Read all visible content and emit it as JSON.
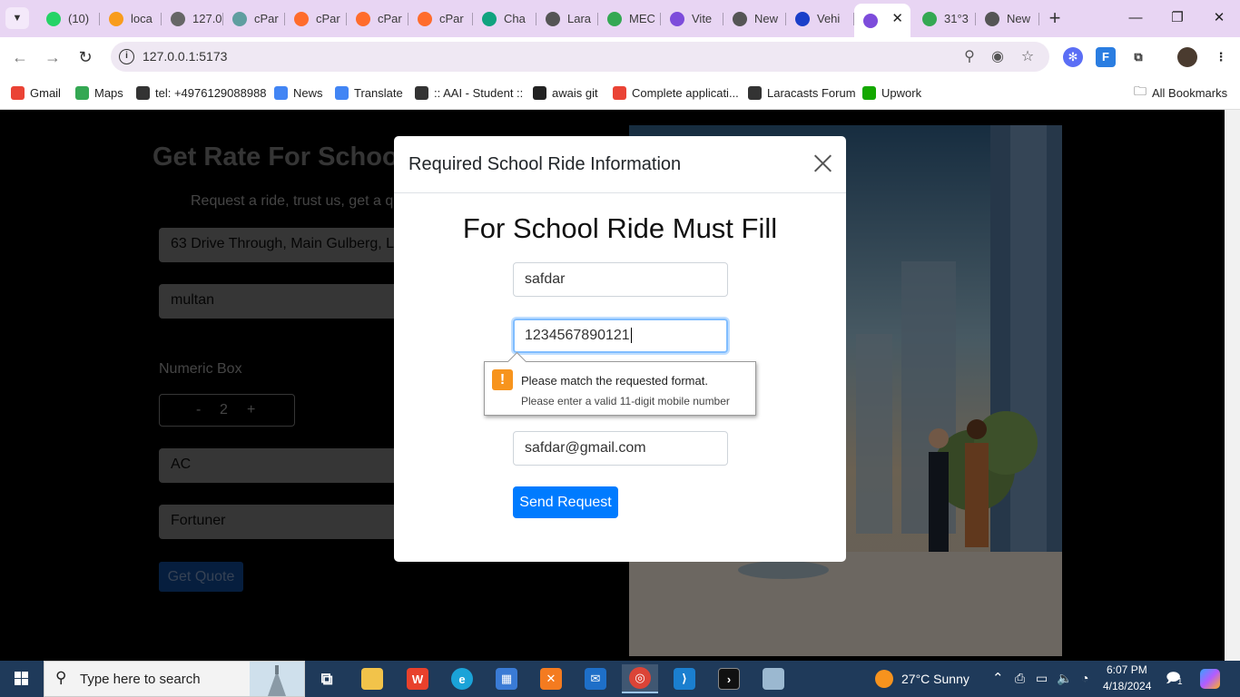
{
  "browser": {
    "tabs": [
      {
        "label": "(10)",
        "icon": "whatsapp-icon",
        "color": "#25d366"
      },
      {
        "label": "loca",
        "icon": "phpmyadmin-icon",
        "color": "#f89c1c"
      },
      {
        "label": "127.0",
        "icon": "globe-icon",
        "color": "#666666"
      },
      {
        "label": "cPar",
        "icon": "cpanel-icon",
        "color": "#5f9ea0"
      },
      {
        "label": "cPar",
        "icon": "cpanel-icon",
        "color": "#ff6c2c"
      },
      {
        "label": "cPar",
        "icon": "cpanel-icon",
        "color": "#ff6c2c"
      },
      {
        "label": "cPar",
        "icon": "cpanel-icon",
        "color": "#ff6c2c"
      },
      {
        "label": "Cha",
        "icon": "chatgpt-icon",
        "color": "#10a37f"
      },
      {
        "label": "Lara",
        "icon": "globe-icon",
        "color": "#555555"
      },
      {
        "label": "MEC",
        "icon": "maps-pin-icon",
        "color": "#34a853"
      },
      {
        "label": "Vite",
        "icon": "vite-icon",
        "color": "#7d4cdb"
      },
      {
        "label": "New",
        "icon": "globe-icon",
        "color": "#555555"
      },
      {
        "label": "Vehi",
        "icon": "shield-icon",
        "color": "#1a3fc9"
      },
      {
        "label": "",
        "icon": "vite-icon",
        "color": "#7d4cdb",
        "active": true
      },
      {
        "label": "31°3",
        "icon": "maps-pin-icon",
        "color": "#34a853"
      },
      {
        "label": "New",
        "icon": "globe-icon",
        "color": "#555555"
      }
    ],
    "close_tab_glyph": "✕",
    "new_tab_glyph": "+",
    "window_controls": {
      "minimize": "—",
      "restore": "❐",
      "close": "✕"
    },
    "url": "127.0.0.1:5173",
    "bookmarks": [
      {
        "label": "Gmail",
        "icon": "gmail-icon",
        "color": "#ea4335"
      },
      {
        "label": "Maps",
        "icon": "maps-pin-icon",
        "color": "#34a853"
      },
      {
        "label": "tel: +4976129088988",
        "icon": "globe-icon",
        "color": "#333333"
      },
      {
        "label": "News",
        "icon": "google-news-icon",
        "color": "#4285f4"
      },
      {
        "label": "Translate",
        "icon": "translate-icon",
        "color": "#4285f4"
      },
      {
        "label": ":: AAI - Student ::",
        "icon": "globe-icon",
        "color": "#333333"
      },
      {
        "label": "awais git",
        "icon": "github-icon",
        "color": "#222222"
      },
      {
        "label": "Complete applicati...",
        "icon": "google-icon",
        "color": "#ea4335"
      },
      {
        "label": "Laracasts Forum",
        "icon": "paper-plane-icon",
        "color": "#333333"
      },
      {
        "label": "Upwork",
        "icon": "upwork-icon",
        "color": "#14a800"
      }
    ],
    "all_bookmarks": "All Bookmarks"
  },
  "page": {
    "title": "Get Rate For School",
    "subtitle": "Request a ride, trust us, get a qu",
    "pickup_value": "63 Drive Through, Main Gulberg, La",
    "destination_value": "multan",
    "numeric_label": "Numeric Box",
    "stepper_minus": "-",
    "stepper_value": "2",
    "stepper_plus": "+",
    "ac_value": "AC",
    "vehicle_value": "Fortuner",
    "get_quote_label": "Get Quote"
  },
  "modal": {
    "title": "Required School Ride Information",
    "heading": "For School Ride Must Fill",
    "name_value": "safdar",
    "phone_value": "1234567890121",
    "email_value": "safdar@gmail.com",
    "send_label": "Send Request",
    "accent": "#007bff"
  },
  "validation": {
    "icon_glyph": "!",
    "message": "Please match the requested format.",
    "detail": "Please enter a valid 11-digit mobile number"
  },
  "taskbar": {
    "search_placeholder": "Type here to search",
    "weather": "27°C  Sunny",
    "time": "6:07 PM",
    "date": "4/18/2024",
    "notifications_count": "1",
    "colors": {
      "bar": "#1f3a5a",
      "weather_sun": "#f7931e"
    }
  }
}
